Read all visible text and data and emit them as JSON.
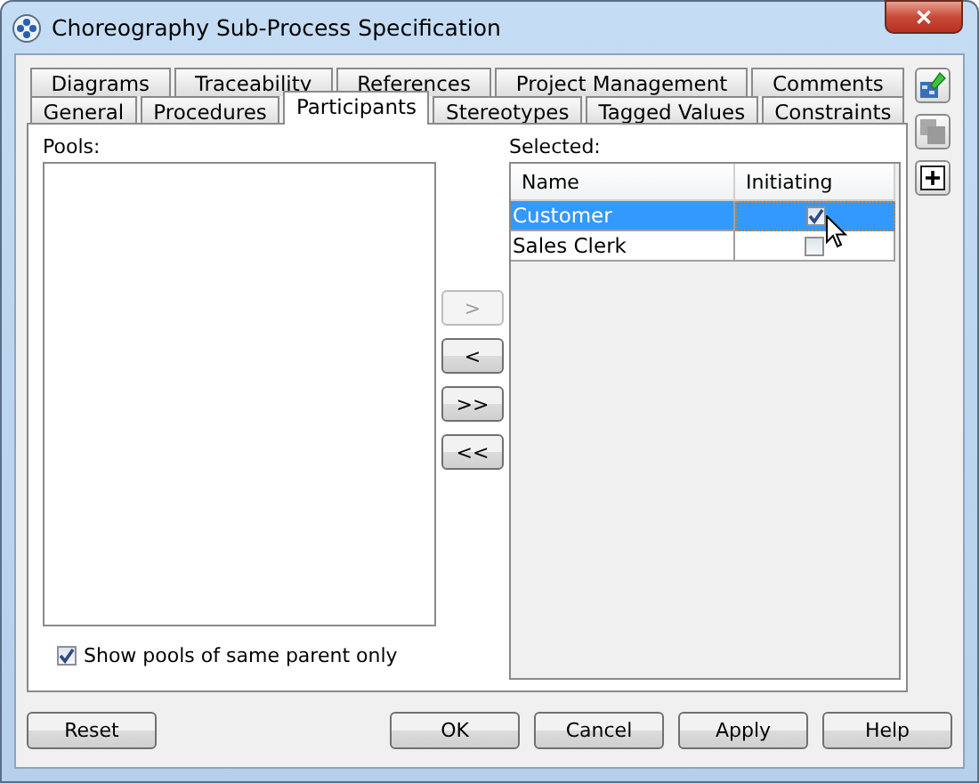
{
  "window": {
    "title": "Choreography Sub-Process Specification",
    "close": "✕"
  },
  "tabs": {
    "back_row": [
      {
        "label": "Diagrams",
        "selected": false
      },
      {
        "label": "Traceability",
        "selected": false
      },
      {
        "label": "References",
        "selected": false
      },
      {
        "label": "Project Management",
        "selected": false
      },
      {
        "label": "Comments",
        "selected": false
      }
    ],
    "front_row": [
      {
        "label": "General",
        "selected": false
      },
      {
        "label": "Procedures",
        "selected": false
      },
      {
        "label": "Participants",
        "selected": true
      },
      {
        "label": "Stereotypes",
        "selected": false
      },
      {
        "label": "Tagged Values",
        "selected": false
      },
      {
        "label": "Constraints",
        "selected": false
      }
    ]
  },
  "pools": {
    "label": "Pools:"
  },
  "transfer_buttons": [
    {
      "label": ">",
      "disabled": true
    },
    {
      "label": "<",
      "disabled": false
    },
    {
      "label": ">>",
      "disabled": false
    },
    {
      "label": "<<",
      "disabled": false
    }
  ],
  "selected": {
    "label": "Selected:",
    "columns": [
      "Name",
      "Initiating"
    ],
    "rows": [
      {
        "name": "Customer",
        "initiating": true,
        "selected": true
      },
      {
        "name": "Sales Clerk",
        "initiating": false,
        "selected": false
      }
    ]
  },
  "show_pools_checkbox": {
    "label": "Show pools of same parent only",
    "checked": true
  },
  "reset_button": "Reset",
  "buttons": [
    "OK",
    "Cancel",
    "Apply",
    "Help"
  ]
}
